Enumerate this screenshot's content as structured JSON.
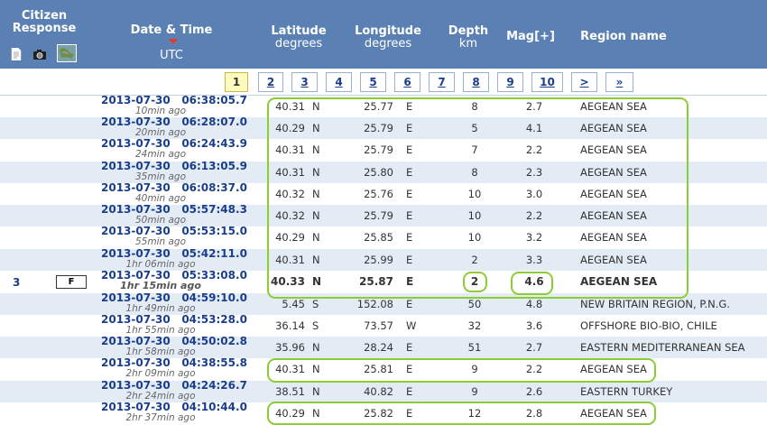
{
  "header": {
    "citizen": "Citizen Response",
    "datetime": "Date & Time",
    "datetime_sub": "UTC",
    "lat": "Latitude",
    "lat_sub": "degrees",
    "lon": "Longitude",
    "lon_sub": "degrees",
    "depth": "Depth",
    "depth_sub": "km",
    "mag": "Mag[+]",
    "region": "Region name"
  },
  "pager": [
    "1",
    "2",
    "3",
    "4",
    "5",
    "6",
    "7",
    "8",
    "9",
    "10",
    ">",
    "»"
  ],
  "current_page": "1",
  "rows": [
    {
      "date": "2013-07-30",
      "time": "06:38:05.7",
      "ago": "10min ago",
      "lat": "40.31",
      "ns": "N",
      "lon": "25.77",
      "ew": "E",
      "depth": "8",
      "mag": "2.7",
      "region": "AEGEAN SEA"
    },
    {
      "date": "2013-07-30",
      "time": "06:28:07.0",
      "ago": "20min ago",
      "lat": "40.29",
      "ns": "N",
      "lon": "25.79",
      "ew": "E",
      "depth": "5",
      "mag": "4.1",
      "region": "AEGEAN SEA"
    },
    {
      "date": "2013-07-30",
      "time": "06:24:43.9",
      "ago": "24min ago",
      "lat": "40.31",
      "ns": "N",
      "lon": "25.79",
      "ew": "E",
      "depth": "7",
      "mag": "2.2",
      "region": "AEGEAN SEA"
    },
    {
      "date": "2013-07-30",
      "time": "06:13:05.9",
      "ago": "35min ago",
      "lat": "40.31",
      "ns": "N",
      "lon": "25.80",
      "ew": "E",
      "depth": "8",
      "mag": "2.3",
      "region": "AEGEAN SEA"
    },
    {
      "date": "2013-07-30",
      "time": "06:08:37.0",
      "ago": "40min ago",
      "lat": "40.32",
      "ns": "N",
      "lon": "25.76",
      "ew": "E",
      "depth": "10",
      "mag": "3.0",
      "region": "AEGEAN SEA"
    },
    {
      "date": "2013-07-30",
      "time": "05:57:48.3",
      "ago": "50min ago",
      "lat": "40.32",
      "ns": "N",
      "lon": "25.79",
      "ew": "E",
      "depth": "10",
      "mag": "2.2",
      "region": "AEGEAN SEA"
    },
    {
      "date": "2013-07-30",
      "time": "05:53:15.0",
      "ago": "55min ago",
      "lat": "40.29",
      "ns": "N",
      "lon": "25.85",
      "ew": "E",
      "depth": "10",
      "mag": "3.2",
      "region": "AEGEAN SEA"
    },
    {
      "date": "2013-07-30",
      "time": "05:42:11.0",
      "ago": "1hr 06min ago",
      "lat": "40.31",
      "ns": "N",
      "lon": "25.99",
      "ew": "E",
      "depth": "2",
      "mag": "3.3",
      "region": "AEGEAN SEA"
    },
    {
      "date": "2013-07-30",
      "time": "05:33:08.0",
      "ago": "1hr 15min ago",
      "lat": "40.33",
      "ns": "N",
      "lon": "25.87",
      "ew": "E",
      "depth": "2",
      "mag": "4.6",
      "region": "AEGEAN SEA",
      "responses": "3",
      "felt": "F"
    },
    {
      "date": "2013-07-30",
      "time": "04:59:10.0",
      "ago": "1hr 49min ago",
      "lat": "5.45",
      "ns": "S",
      "lon": "152.08",
      "ew": "E",
      "depth": "50",
      "mag": "4.8",
      "region": "NEW BRITAIN REGION, P.N.G."
    },
    {
      "date": "2013-07-30",
      "time": "04:53:28.0",
      "ago": "1hr 55min ago",
      "lat": "36.14",
      "ns": "S",
      "lon": "73.57",
      "ew": "W",
      "depth": "32",
      "mag": "3.6",
      "region": "OFFSHORE BIO-BIO, CHILE"
    },
    {
      "date": "2013-07-30",
      "time": "04:50:02.8",
      "ago": "1hr 58min ago",
      "lat": "35.96",
      "ns": "N",
      "lon": "28.24",
      "ew": "E",
      "depth": "51",
      "mag": "2.7",
      "region": "EASTERN MEDITERRANEAN SEA"
    },
    {
      "date": "2013-07-30",
      "time": "04:38:55.8",
      "ago": "2hr 09min ago",
      "lat": "40.31",
      "ns": "N",
      "lon": "25.81",
      "ew": "E",
      "depth": "9",
      "mag": "2.2",
      "region": "AEGEAN SEA"
    },
    {
      "date": "2013-07-30",
      "time": "04:24:26.7",
      "ago": "2hr 24min ago",
      "lat": "38.51",
      "ns": "N",
      "lon": "40.82",
      "ew": "E",
      "depth": "9",
      "mag": "2.6",
      "region": "EASTERN TURKEY"
    },
    {
      "date": "2013-07-30",
      "time": "04:10:44.0",
      "ago": "2hr 37min ago",
      "lat": "40.29",
      "ns": "N",
      "lon": "25.82",
      "ew": "E",
      "depth": "12",
      "mag": "2.8",
      "region": "AEGEAN SEA"
    }
  ],
  "colors": {
    "header": "#5b80b3",
    "alt_row": "#e3ebf5",
    "highlight_outline": "#8ccc35",
    "link": "#1a3e8c"
  }
}
